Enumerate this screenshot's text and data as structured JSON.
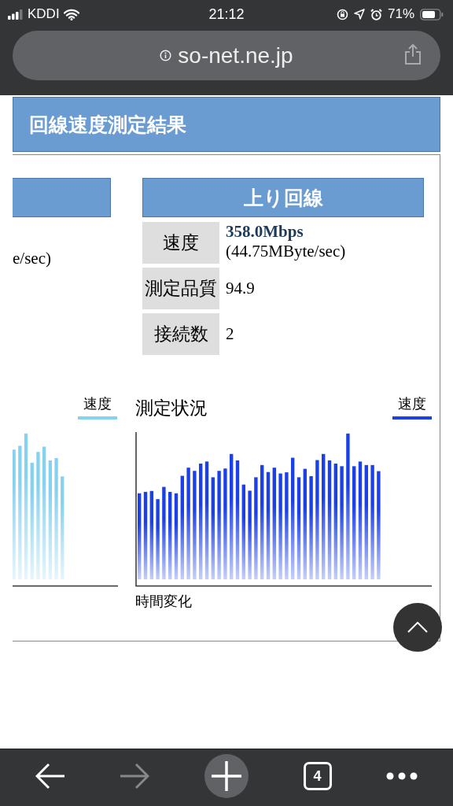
{
  "status_bar": {
    "carrier": "KDDI",
    "time": "21:12",
    "battery": "71%"
  },
  "address_bar": {
    "url": "so-net.ne.jp"
  },
  "page_title": "回線速度測定結果",
  "download_panel": {
    "cut_text": "e/sec)",
    "chart": {
      "legend": "速度",
      "color": "#86d0f0"
    }
  },
  "upload_panel": {
    "header": "上り回線",
    "rows": [
      {
        "label": "速度",
        "value": "358.0Mbps",
        "sub": "(44.75MByte/sec)"
      },
      {
        "label": "測定品質",
        "value": "94.9"
      },
      {
        "label": "接続数",
        "value": "2"
      }
    ],
    "chart": {
      "title": "測定状況",
      "legend": "速度",
      "color": "#1c40e8",
      "xlabel": "時間変化"
    }
  },
  "toolbar": {
    "forward_enabled": false,
    "tab_count": "4"
  }
}
